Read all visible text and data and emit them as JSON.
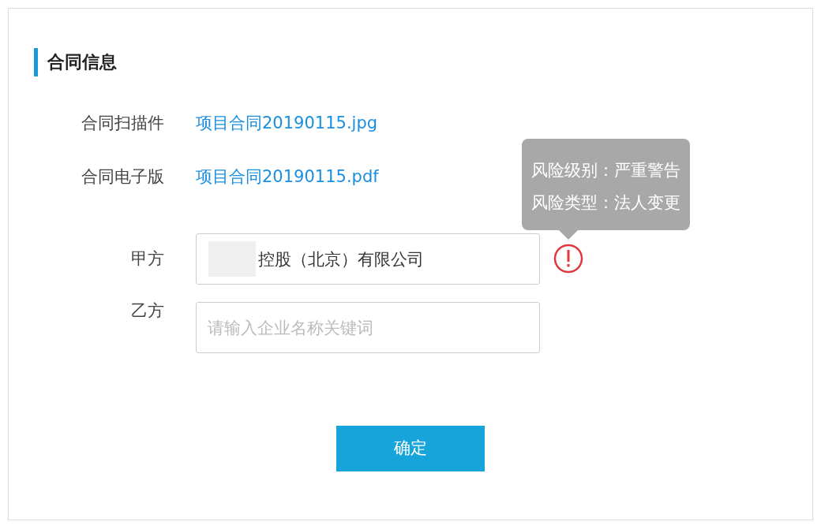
{
  "section": {
    "title": "合同信息"
  },
  "files": [
    {
      "label": "合同扫描件",
      "link": "项目合同20190115.jpg"
    },
    {
      "label": "合同电子版",
      "link": "项目合同20190115.pdf"
    }
  ],
  "parties": [
    {
      "label": "甲方",
      "value": "控股（北京）有限公司",
      "redacted": true,
      "warning": true,
      "tooltip": [
        "风险级别：严重警告",
        "风险类型：法人变更"
      ]
    },
    {
      "label": "乙方",
      "placeholder": "请输入企业名称关键词",
      "redacted": false,
      "warning": false
    }
  ],
  "button": "确定"
}
